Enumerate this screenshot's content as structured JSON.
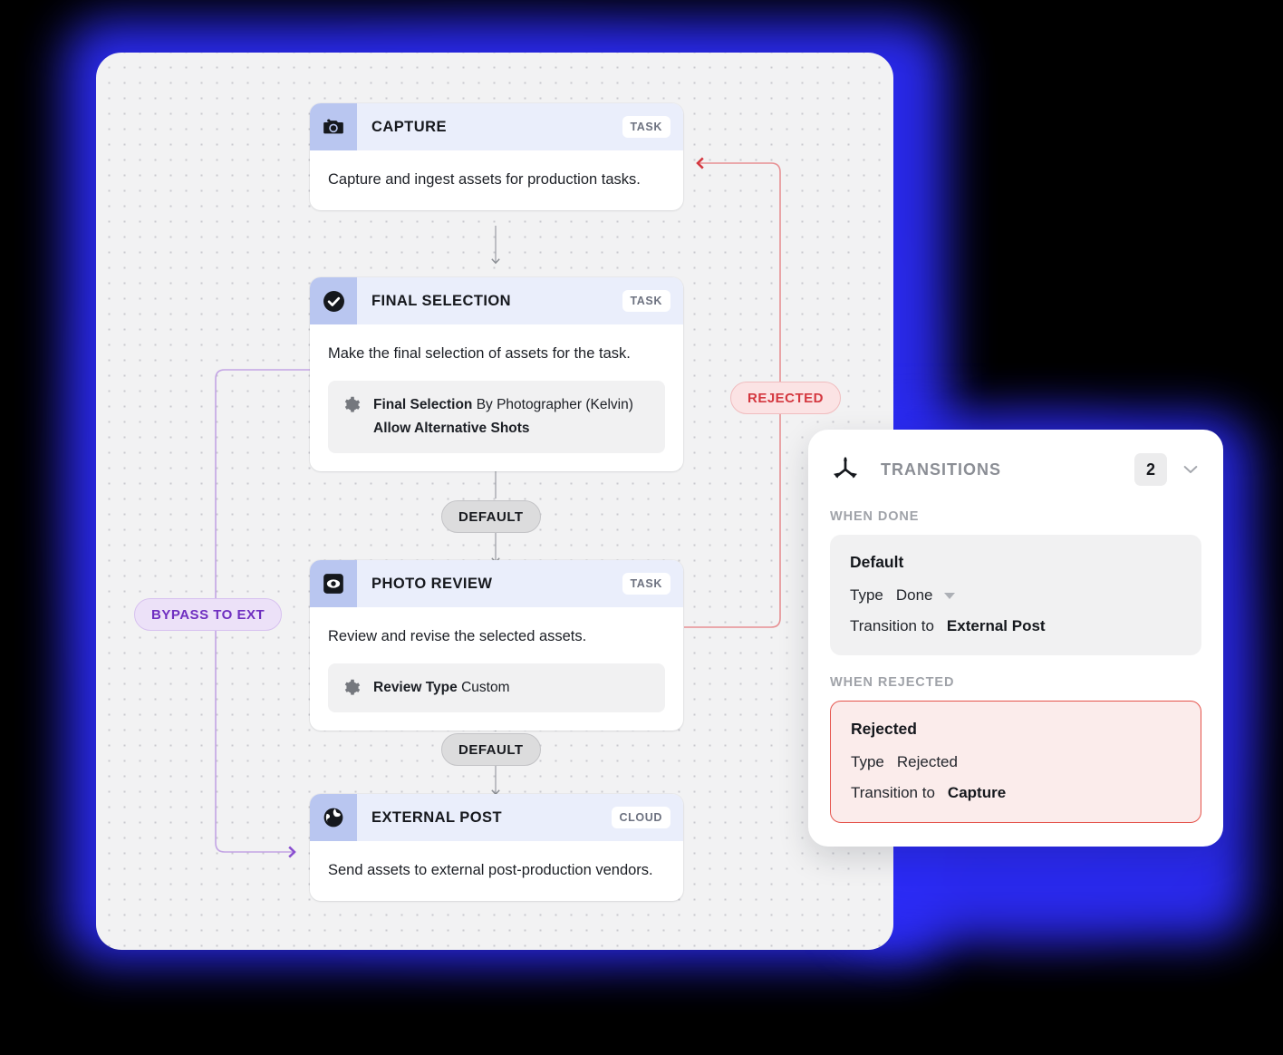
{
  "canvas": {
    "nodes": [
      {
        "id": "capture",
        "icon": "camera-icon",
        "title": "CAPTURE",
        "badge": "TASK",
        "description": "Capture and ingest assets for production tasks.",
        "properties": []
      },
      {
        "id": "final-selection",
        "icon": "check-circle-icon",
        "title": "FINAL SELECTION",
        "badge": "TASK",
        "description": "Make the final selection of assets for the task.",
        "properties": [
          {
            "icon": "gear-icon",
            "label": "Final Selection",
            "value": "By Photographer (Kelvin)",
            "extra": "Allow Alternative Shots"
          }
        ]
      },
      {
        "id": "photo-review",
        "icon": "eye-icon",
        "title": "PHOTO REVIEW",
        "badge": "TASK",
        "description": "Review and revise the selected assets.",
        "properties": [
          {
            "icon": "gear-icon",
            "label": "Review Type",
            "value": "Custom",
            "extra": ""
          }
        ]
      },
      {
        "id": "external-post",
        "icon": "globe-icon",
        "title": "EXTERNAL POST",
        "badge": "CLOUD",
        "description": "Send assets to external post-production vendors.",
        "properties": []
      }
    ],
    "edges": [
      {
        "id": "edge-default-1",
        "label": "DEFAULT",
        "style": "default",
        "color": "#17191e"
      },
      {
        "id": "edge-default-2",
        "label": "DEFAULT",
        "style": "default",
        "color": "#17191e"
      },
      {
        "id": "edge-rejected",
        "label": "REJECTED",
        "style": "rejected",
        "color": "#e06b6e"
      },
      {
        "id": "edge-bypass",
        "label": "BYPASS TO EXT",
        "style": "bypass",
        "color": "#b38ddb"
      }
    ]
  },
  "panel": {
    "icon": "branch-icon",
    "title": "TRANSITIONS",
    "count": "2",
    "collapse_icon": "chevron-down-icon",
    "sections": [
      {
        "label": "WHEN DONE",
        "transition": {
          "name": "Default",
          "type_label": "Type",
          "type_value": "Done",
          "has_dropdown": true,
          "target_label": "Transition to",
          "target_value": "External Post"
        }
      },
      {
        "label": "WHEN REJECTED",
        "transition": {
          "name": "Rejected",
          "type_label": "Type",
          "type_value": "Rejected",
          "has_dropdown": false,
          "target_label": "Transition to",
          "target_value": "Capture"
        }
      }
    ]
  }
}
